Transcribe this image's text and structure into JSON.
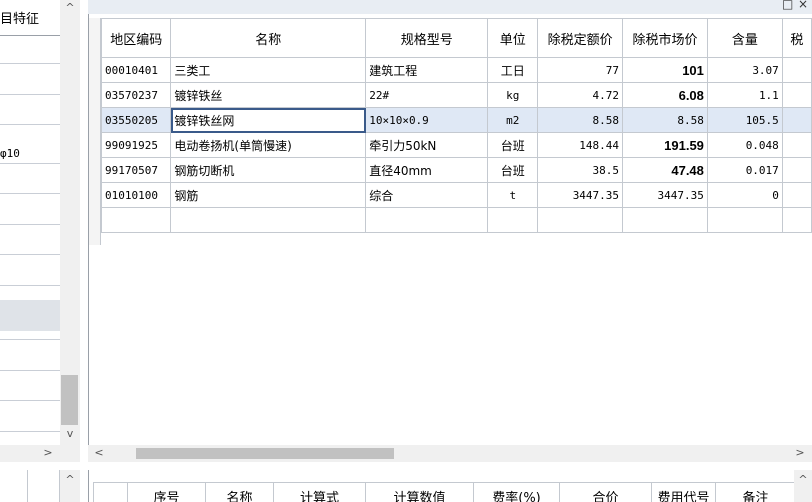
{
  "left_panel": {
    "header": "目特征",
    "selected_cell_text": "φ10"
  },
  "window_controls": {
    "restore": "□",
    "close": "×"
  },
  "grid": {
    "columns": [
      "地区编码",
      "名称",
      "规格型号",
      "单位",
      "除税定额价",
      "除税市场价",
      "含量",
      "税"
    ],
    "rows": [
      {
        "code": "00010401",
        "name": "三类工",
        "spec": "建筑工程",
        "unit": "工日",
        "quota_price": "77",
        "market_price": "101",
        "qty": "3.07"
      },
      {
        "code": "03570237",
        "name": "镀锌铁丝",
        "spec": "22#",
        "unit": "kg",
        "quota_price": "4.72",
        "market_price": "6.08",
        "qty": "1.1"
      },
      {
        "code": "03550205",
        "name": "镀锌铁丝网",
        "spec": "10×10×0.9",
        "unit": "m2",
        "quota_price": "8.58",
        "market_price": "8.58",
        "qty": "105.5"
      },
      {
        "code": "99091925",
        "name": "电动卷扬机(单筒慢速)",
        "spec": "牵引力50kN",
        "unit": "台班",
        "quota_price": "148.44",
        "market_price": "191.59",
        "qty": "0.048"
      },
      {
        "code": "99170507",
        "name": "钢筋切断机",
        "spec": "直径40mm",
        "unit": "台班",
        "quota_price": "38.5",
        "market_price": "47.48",
        "qty": "0.017"
      },
      {
        "code": "01010100",
        "name": "钢筋",
        "spec": "综合",
        "unit": "t",
        "quota_price": "3447.35",
        "market_price": "3447.35",
        "qty": "0"
      }
    ]
  },
  "bottom_grid": {
    "columns": [
      "",
      "序号",
      "名称",
      "计算式",
      "计算数值",
      "费率(%)",
      "合价",
      "费用代号",
      "备注"
    ]
  },
  "scroll_arrows": {
    "up": "^",
    "down": "v",
    "left": "<",
    "right": ">"
  },
  "colors": {
    "selected_row": "#dfe8f5",
    "focus_border": "#3a5a8a",
    "scroll_thumb": "#c1c1c1"
  }
}
